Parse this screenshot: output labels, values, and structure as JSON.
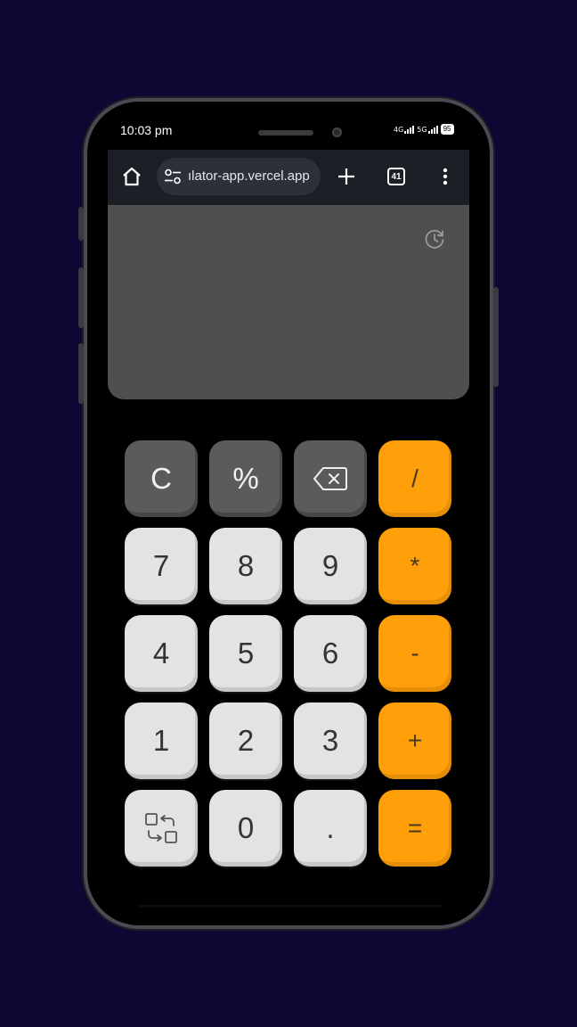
{
  "status_bar": {
    "time": "10:03 pm",
    "net1": "4G",
    "net2": "5G",
    "battery": "95"
  },
  "browser": {
    "url": "ılator-app.vercel.app",
    "tab_count": "41",
    "icons": [
      "home-icon",
      "site-settings-icon",
      "new-tab-icon",
      "tab-switcher-icon",
      "menu-icon"
    ]
  },
  "display": {
    "history_icon": "history-icon",
    "background": "#4f4f4f"
  },
  "keypad": {
    "row1": {
      "clear": "C",
      "percent": "%",
      "backspace_icon": "backspace-icon",
      "divide": "/"
    },
    "row2": {
      "seven": "7",
      "eight": "8",
      "nine": "9",
      "multiply": "*"
    },
    "row3": {
      "four": "4",
      "five": "5",
      "six": "6",
      "minus": "-"
    },
    "row4": {
      "one": "1",
      "two": "2",
      "three": "3",
      "plus": "+"
    },
    "row5": {
      "swap_icon": "swap-mode-icon",
      "zero": "0",
      "dot": ".",
      "equals": "="
    }
  },
  "colors": {
    "page_bg": "#0f0633",
    "key_light": "#e3e3e3",
    "key_dark": "#5b5b5b",
    "key_orange": "#ff9f0a"
  }
}
